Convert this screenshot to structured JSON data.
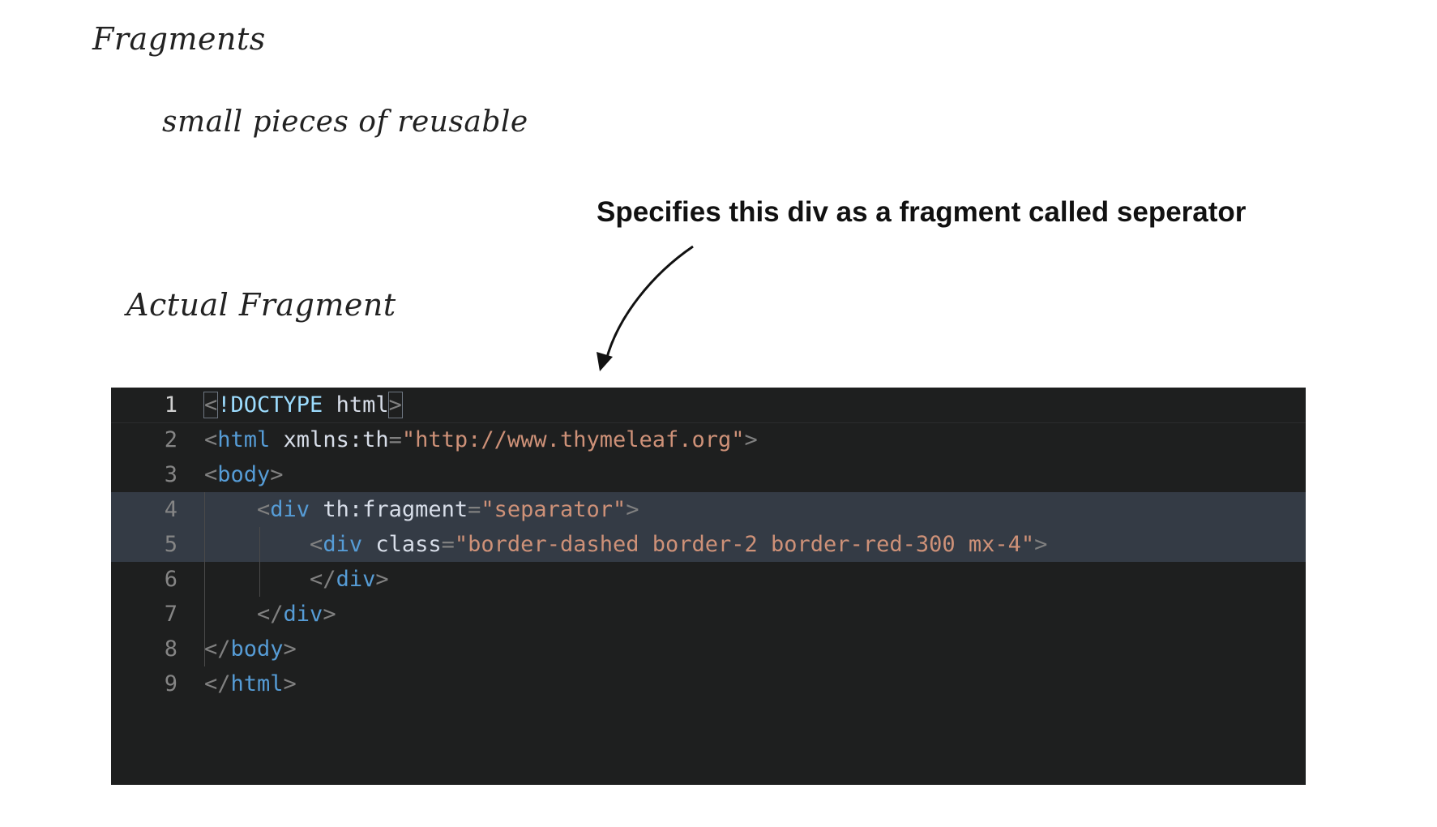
{
  "slide": {
    "title": "Fragments",
    "subtitle": "small pieces of reusable",
    "section_heading": "Actual Fragment",
    "annotation": "Specifies this div as a fragment called seperator"
  },
  "editor": {
    "line_numbers": [
      "1",
      "2",
      "3",
      "4",
      "5",
      "6",
      "7",
      "8",
      "9"
    ],
    "lines": [
      {
        "tokens": [
          {
            "t": "<",
            "c": "t-br",
            "box": true
          },
          {
            "t": "!DOCTYPE",
            "c": "t-plain"
          },
          {
            "t": " html",
            "c": "t-attr"
          },
          {
            "t": ">",
            "c": "t-br",
            "box": true
          }
        ]
      },
      {
        "tokens": [
          {
            "t": "<",
            "c": "t-br"
          },
          {
            "t": "html",
            "c": "t-tag"
          },
          {
            "t": " xmlns:th",
            "c": "t-attr"
          },
          {
            "t": "=",
            "c": "t-eq"
          },
          {
            "t": "\"http://www.thymeleaf.org\"",
            "c": "t-str"
          },
          {
            "t": ">",
            "c": "t-br"
          }
        ]
      },
      {
        "tokens": [
          {
            "t": "<",
            "c": "t-br"
          },
          {
            "t": "body",
            "c": "t-tag"
          },
          {
            "t": ">",
            "c": "t-br"
          }
        ]
      },
      {
        "tokens": [
          {
            "t": "    <",
            "c": "t-br"
          },
          {
            "t": "div",
            "c": "t-tag"
          },
          {
            "t": " th:fragment",
            "c": "t-attr"
          },
          {
            "t": "=",
            "c": "t-eq"
          },
          {
            "t": "\"separator\"",
            "c": "t-str"
          },
          {
            "t": ">",
            "c": "t-br"
          }
        ]
      },
      {
        "tokens": [
          {
            "t": "        <",
            "c": "t-br"
          },
          {
            "t": "div",
            "c": "t-tag"
          },
          {
            "t": " class",
            "c": "t-attr"
          },
          {
            "t": "=",
            "c": "t-eq"
          },
          {
            "t": "\"border-dashed border-2 border-red-300 mx-4\"",
            "c": "t-str"
          },
          {
            "t": ">",
            "c": "t-br"
          }
        ]
      },
      {
        "tokens": [
          {
            "t": "        </",
            "c": "t-br"
          },
          {
            "t": "div",
            "c": "t-tag"
          },
          {
            "t": ">",
            "c": "t-br"
          }
        ]
      },
      {
        "tokens": [
          {
            "t": "    </",
            "c": "t-br"
          },
          {
            "t": "div",
            "c": "t-tag"
          },
          {
            "t": ">",
            "c": "t-br"
          }
        ]
      },
      {
        "tokens": [
          {
            "t": "</",
            "c": "t-br"
          },
          {
            "t": "body",
            "c": "t-tag"
          },
          {
            "t": ">",
            "c": "t-br"
          }
        ]
      },
      {
        "tokens": [
          {
            "t": "</",
            "c": "t-br"
          },
          {
            "t": "html",
            "c": "t-tag"
          },
          {
            "t": ">",
            "c": "t-br"
          }
        ]
      }
    ]
  }
}
